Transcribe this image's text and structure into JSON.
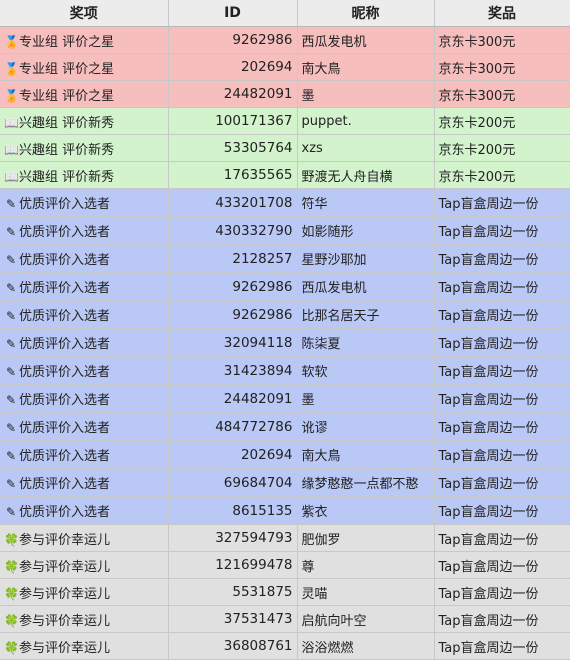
{
  "headers": [
    "奖项",
    "ID",
    "昵称",
    "奖品"
  ],
  "rows": [
    {
      "group": "pink",
      "icon": "🏅",
      "icon_name": "medal-icon",
      "award": "专业组 评价之星",
      "id": "9262986",
      "nick": "西瓜发电机",
      "prize": "京东卡300元"
    },
    {
      "group": "pink",
      "icon": "🏅",
      "icon_name": "medal-icon",
      "award": "专业组 评价之星",
      "id": "202694",
      "nick": "南大鳥",
      "prize": "京东卡300元"
    },
    {
      "group": "pink",
      "icon": "🏅",
      "icon_name": "medal-icon",
      "award": "专业组 评价之星",
      "id": "24482091",
      "nick": "墨",
      "prize": "京东卡300元"
    },
    {
      "group": "green",
      "icon": "📖",
      "icon_name": "book-icon",
      "award": "兴趣组 评价新秀",
      "id": "100171367",
      "nick": "puppet.",
      "prize": "京东卡200元"
    },
    {
      "group": "green",
      "icon": "📖",
      "icon_name": "book-icon",
      "award": "兴趣组 评价新秀",
      "id": "53305764",
      "nick": "xzs",
      "prize": "京东卡200元"
    },
    {
      "group": "green",
      "icon": "📖",
      "icon_name": "book-icon",
      "award": "兴趣组 评价新秀",
      "id": "17635565",
      "nick": "野渡无人舟自横",
      "prize": "京东卡200元"
    },
    {
      "group": "blue",
      "icon": "✎",
      "icon_name": "pencil-icon",
      "award": "优质评价入选者",
      "id": "433201708",
      "nick": "符华",
      "prize": "Tap盲盒周边一份"
    },
    {
      "group": "blue",
      "icon": "✎",
      "icon_name": "pencil-icon",
      "award": "优质评价入选者",
      "id": "430332790",
      "nick": "如影随形",
      "prize": "Tap盲盒周边一份"
    },
    {
      "group": "blue",
      "icon": "✎",
      "icon_name": "pencil-icon",
      "award": "优质评价入选者",
      "id": "2128257",
      "nick": "星野沙耶加",
      "prize": "Tap盲盒周边一份"
    },
    {
      "group": "blue",
      "icon": "✎",
      "icon_name": "pencil-icon",
      "award": "优质评价入选者",
      "id": "9262986",
      "nick": "西瓜发电机",
      "prize": "Tap盲盒周边一份"
    },
    {
      "group": "blue",
      "icon": "✎",
      "icon_name": "pencil-icon",
      "award": "优质评价入选者",
      "id": "9262986",
      "nick": "比那名居天子",
      "prize": "Tap盲盒周边一份"
    },
    {
      "group": "blue",
      "icon": "✎",
      "icon_name": "pencil-icon",
      "award": "优质评价入选者",
      "id": "32094118",
      "nick": "陈柒夏",
      "prize": "Tap盲盒周边一份"
    },
    {
      "group": "blue",
      "icon": "✎",
      "icon_name": "pencil-icon",
      "award": "优质评价入选者",
      "id": "31423894",
      "nick": "软软",
      "prize": "Tap盲盒周边一份"
    },
    {
      "group": "blue",
      "icon": "✎",
      "icon_name": "pencil-icon",
      "award": "优质评价入选者",
      "id": "24482091",
      "nick": "墨",
      "prize": "Tap盲盒周边一份"
    },
    {
      "group": "blue",
      "icon": "✎",
      "icon_name": "pencil-icon",
      "award": "优质评价入选者",
      "id": "484772786",
      "nick": "讹谬",
      "prize": "Tap盲盒周边一份"
    },
    {
      "group": "blue",
      "icon": "✎",
      "icon_name": "pencil-icon",
      "award": "优质评价入选者",
      "id": "202694",
      "nick": "南大鳥",
      "prize": "Tap盲盒周边一份"
    },
    {
      "group": "blue",
      "icon": "✎",
      "icon_name": "pencil-icon",
      "award": "优质评价入选者",
      "id": "69684704",
      "nick": "缘梦憨憨一点都不憨",
      "prize": "Tap盲盒周边一份"
    },
    {
      "group": "blue",
      "icon": "✎",
      "icon_name": "pencil-icon",
      "award": "优质评价入选者",
      "id": "8615135",
      "nick": "紫衣",
      "prize": "Tap盲盒周边一份"
    },
    {
      "group": "gray",
      "icon": "🍀",
      "icon_name": "clover-icon",
      "award": "参与评价幸运儿",
      "id": "327594793",
      "nick": "肥伽罗",
      "prize": "Tap盲盒周边一份"
    },
    {
      "group": "gray",
      "icon": "🍀",
      "icon_name": "clover-icon",
      "award": "参与评价幸运儿",
      "id": "121699478",
      "nick": "尊",
      "prize": "Tap盲盒周边一份"
    },
    {
      "group": "gray",
      "icon": "🍀",
      "icon_name": "clover-icon",
      "award": "参与评价幸运儿",
      "id": "5531875",
      "nick": "灵喵",
      "prize": "Tap盲盒周边一份"
    },
    {
      "group": "gray",
      "icon": "🍀",
      "icon_name": "clover-icon",
      "award": "参与评价幸运儿",
      "id": "37531473",
      "nick": "启航向叶空",
      "prize": "Tap盲盒周边一份"
    },
    {
      "group": "gray",
      "icon": "🍀",
      "icon_name": "clover-icon",
      "award": "参与评价幸运儿",
      "id": "36808761",
      "nick": "浴浴燃燃",
      "prize": "Tap盲盒周边一份"
    }
  ]
}
